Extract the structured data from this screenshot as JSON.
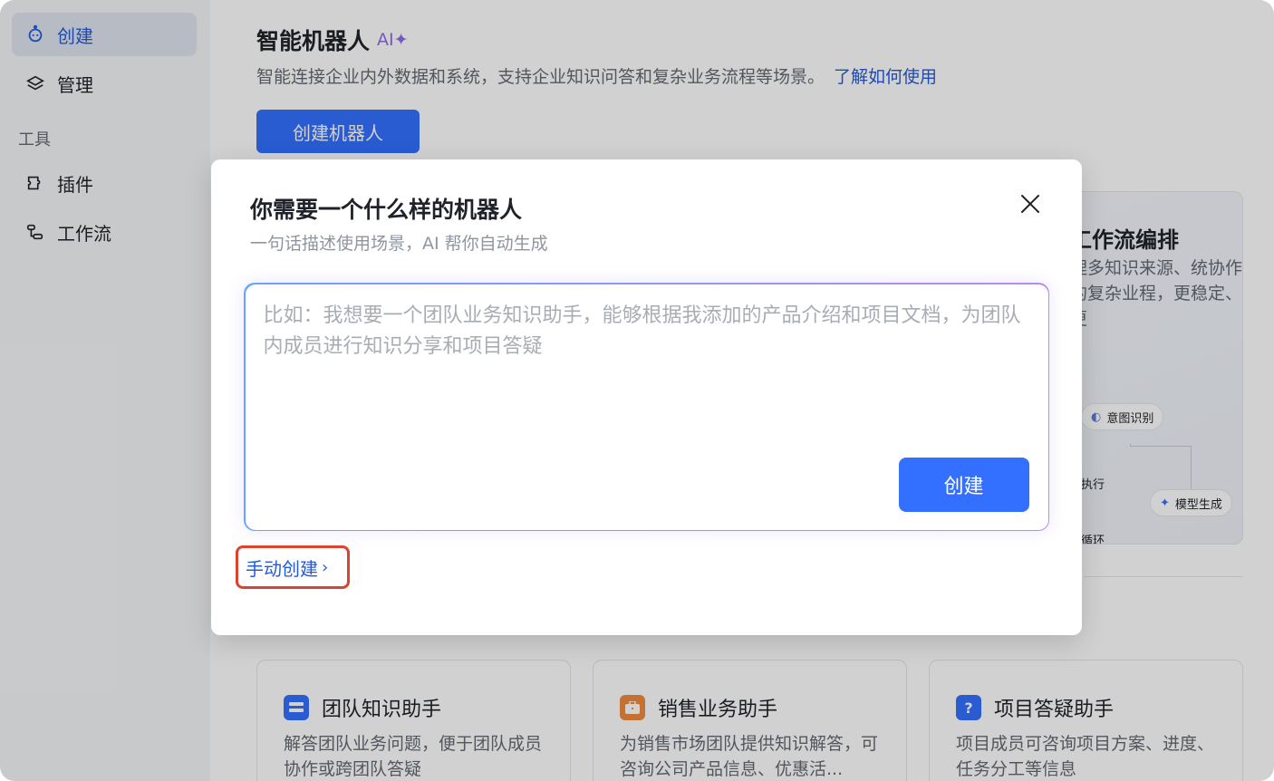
{
  "sidebar": {
    "items": [
      {
        "label": "创建",
        "icon": "robot-icon",
        "active": true
      },
      {
        "label": "管理",
        "icon": "layers-icon",
        "active": false
      }
    ],
    "section_label": "工具",
    "tools": [
      {
        "label": "插件",
        "icon": "plugin-icon"
      },
      {
        "label": "工作流",
        "icon": "workflow-icon"
      }
    ]
  },
  "header": {
    "title": "智能机器人",
    "ai_badge": "AI✦",
    "subtitle": "智能连接企业内外数据和系统，支持企业知识问答和复杂业务流程等场景。",
    "learn_link": "了解如何使用",
    "create_button": "创建机器人"
  },
  "feature": {
    "title": "工作流编排",
    "desc": "理多知识来源、统协作的复杂业程，更稳定、更",
    "nodes": {
      "intent": "意图识别",
      "exec": "执行",
      "model": "模型生成",
      "loop": "循环"
    }
  },
  "templates": [
    {
      "title": "团队知识助手",
      "desc": "解答团队业务问题，便于团队成员协作或跨团队答疑",
      "color": "#3370ff",
      "icon": "list-icon"
    },
    {
      "title": "销售业务助手",
      "desc": "为销售市场团队提供知识解答，可咨询公司产品信息、优惠活...",
      "color": "#f08a3e",
      "icon": "briefcase-icon"
    },
    {
      "title": "项目答疑助手",
      "desc": "项目成员可咨询项目方案、进度、任务分工等信息",
      "color": "#3370ff",
      "icon": "question-icon"
    }
  ],
  "modal": {
    "title": "你需要一个什么样的机器人",
    "subtitle": "一句话描述使用场景，AI 帮你自动生成",
    "placeholder": "比如：我想要一个团队业务知识助手，能够根据我添加的产品介绍和项目文档，为团队内成员进行知识分享和项目答疑",
    "submit": "创建",
    "manual": "手动创建"
  },
  "colors": {
    "primary": "#3370ff",
    "highlight": "#d9442f"
  }
}
